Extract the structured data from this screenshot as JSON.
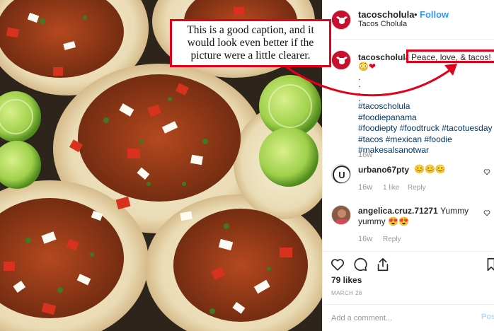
{
  "post": {
    "username": "tacoscholula",
    "follow_label": "Follow",
    "dot": "•",
    "location": "Tacos Cholula"
  },
  "caption": {
    "username": "tacoscholula",
    "text": "Peace, love, & tacos!",
    "emoji_face": "😳",
    "emoji_heart": "❤",
    "dots": [
      ".",
      ".",
      ".",
      "."
    ],
    "hashtags": [
      "#tacoscholula",
      "#foodiepanama",
      "#foodiepty",
      "#foodtruck",
      "#tacotuesday",
      "#tacos",
      "#mexican",
      "#foodie",
      "#makesalsanotwar"
    ],
    "time": "16w"
  },
  "comments": [
    {
      "username": "urbano67pty",
      "text": "",
      "emoji": "😊😊😊",
      "time": "16w",
      "likes": "1 like",
      "reply": "Reply",
      "avatar_label": "U"
    },
    {
      "username": "angelica.cruz.71271",
      "text": "Yummy yummy",
      "emoji": "😍😍",
      "time": "16w",
      "likes": "",
      "reply": "Reply"
    }
  ],
  "stats": {
    "likes": "79 likes",
    "date": "MARCH 28"
  },
  "add_comment": {
    "placeholder": "Add a comment...",
    "post_label": "Post"
  },
  "annotation": {
    "text": "This is a good caption, and it would look even better if the picture were a little clearer."
  },
  "colors": {
    "accent_blue": "#3897f0",
    "hashtag": "#003569",
    "annotation_red": "#e3001b",
    "muted": "#999999"
  }
}
